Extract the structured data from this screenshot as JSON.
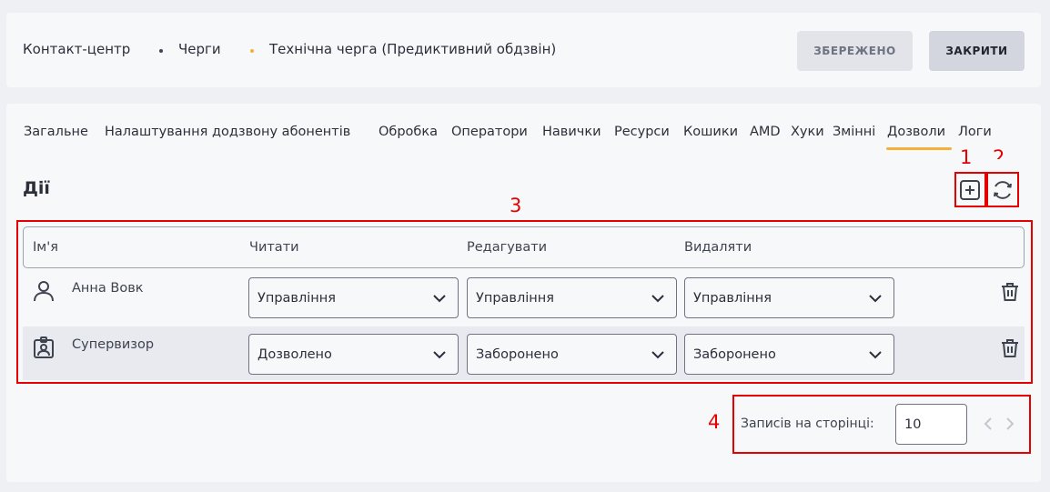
{
  "breadcrumb": {
    "items": [
      "Контакт-центр",
      "Черги",
      "Технічна черга (Предиктивний обдзвін)"
    ],
    "dot_colors": [
      "#3e4558",
      "#f3b13a"
    ]
  },
  "toolbar": {
    "saved_label": "ЗБЕРЕЖЕНО",
    "close_label": "ЗАКРИТИ"
  },
  "tabs": [
    "Загальне",
    "Налаштування додзвону абонентів",
    "Обробка",
    "Оператори",
    "Навички",
    "Ресурси",
    "Кошики",
    "AMD",
    "Хуки",
    "Змінні",
    "Дозволи",
    "Логи"
  ],
  "active_tab": "Дозволи",
  "section": {
    "title": "Дії"
  },
  "icons": {
    "add": "plus-square-icon",
    "refresh": "refresh-icon",
    "user": "user-icon",
    "role": "badge-icon",
    "delete": "trash-icon"
  },
  "table": {
    "headers": [
      "Ім'я",
      "Читати",
      "Редагувати",
      "Видаляти"
    ],
    "rows": [
      {
        "name": "Анна Вовк",
        "read": "Управління",
        "edit": "Управління",
        "delete": "Управління"
      },
      {
        "name": "Супервизор",
        "read": "Дозволено",
        "edit": "Заборонено",
        "delete": "Заборонено"
      }
    ]
  },
  "pagination": {
    "label": "Записів на сторінці:",
    "per_page": "10"
  },
  "annotations": {
    "a1": "1",
    "a2": "2",
    "a3": "3",
    "a4": "4",
    "color": "#e60000"
  },
  "colors": {
    "accent": "#f3b13a",
    "annotation": "#e60000"
  }
}
